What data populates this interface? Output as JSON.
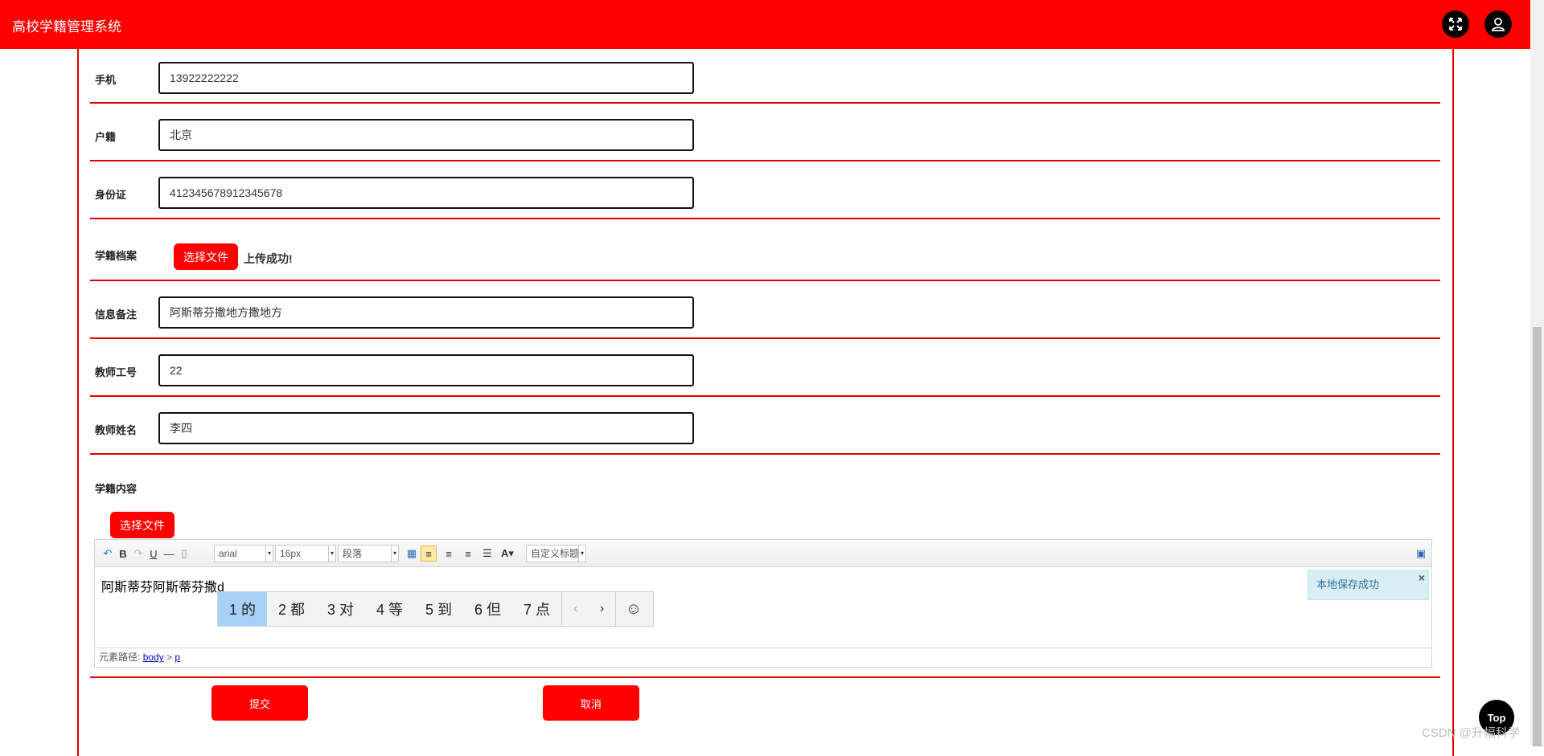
{
  "header": {
    "title": "高校学籍管理系统",
    "fullscreen_icon": "fullscreen-icon",
    "user_icon": "user-icon"
  },
  "form": {
    "phone": {
      "label": "手机",
      "value": "13922222222"
    },
    "hukou": {
      "label": "户籍",
      "value": "北京"
    },
    "idcard": {
      "label": "身份证",
      "value": "412345678912345678"
    },
    "archive": {
      "label": "学籍档案",
      "button": "选择文件",
      "status": "上传成功!"
    },
    "remark": {
      "label": "信息备注",
      "value": "阿斯蒂芬撒地方撒地方"
    },
    "teacher_no": {
      "label": "教师工号",
      "value": "22"
    },
    "teacher_name": {
      "label": "教师姓名",
      "value": "李四"
    },
    "content": {
      "label": "学籍内容",
      "button": "选择文件"
    }
  },
  "editor": {
    "font_family": "arial",
    "font_size": "16px",
    "paragraph": "段落",
    "custom_title": "自定义标题",
    "text": "阿斯蒂芬阿斯蒂芬撒d",
    "path_label": "元素路径:",
    "path_body": "body",
    "path_sep": ">",
    "path_p": "p",
    "toast": "本地保存成功",
    "toast_close": "×"
  },
  "ime": {
    "candidates": [
      "1 的",
      "2 都",
      "3 对",
      "4 等",
      "5 到",
      "6 但",
      "7 点"
    ],
    "prev": "‹",
    "next": "›",
    "emoji": "☺"
  },
  "actions": {
    "submit": "提交",
    "cancel": "取消"
  },
  "top_button": "Top",
  "watermark": "CSDN @升幅科学"
}
